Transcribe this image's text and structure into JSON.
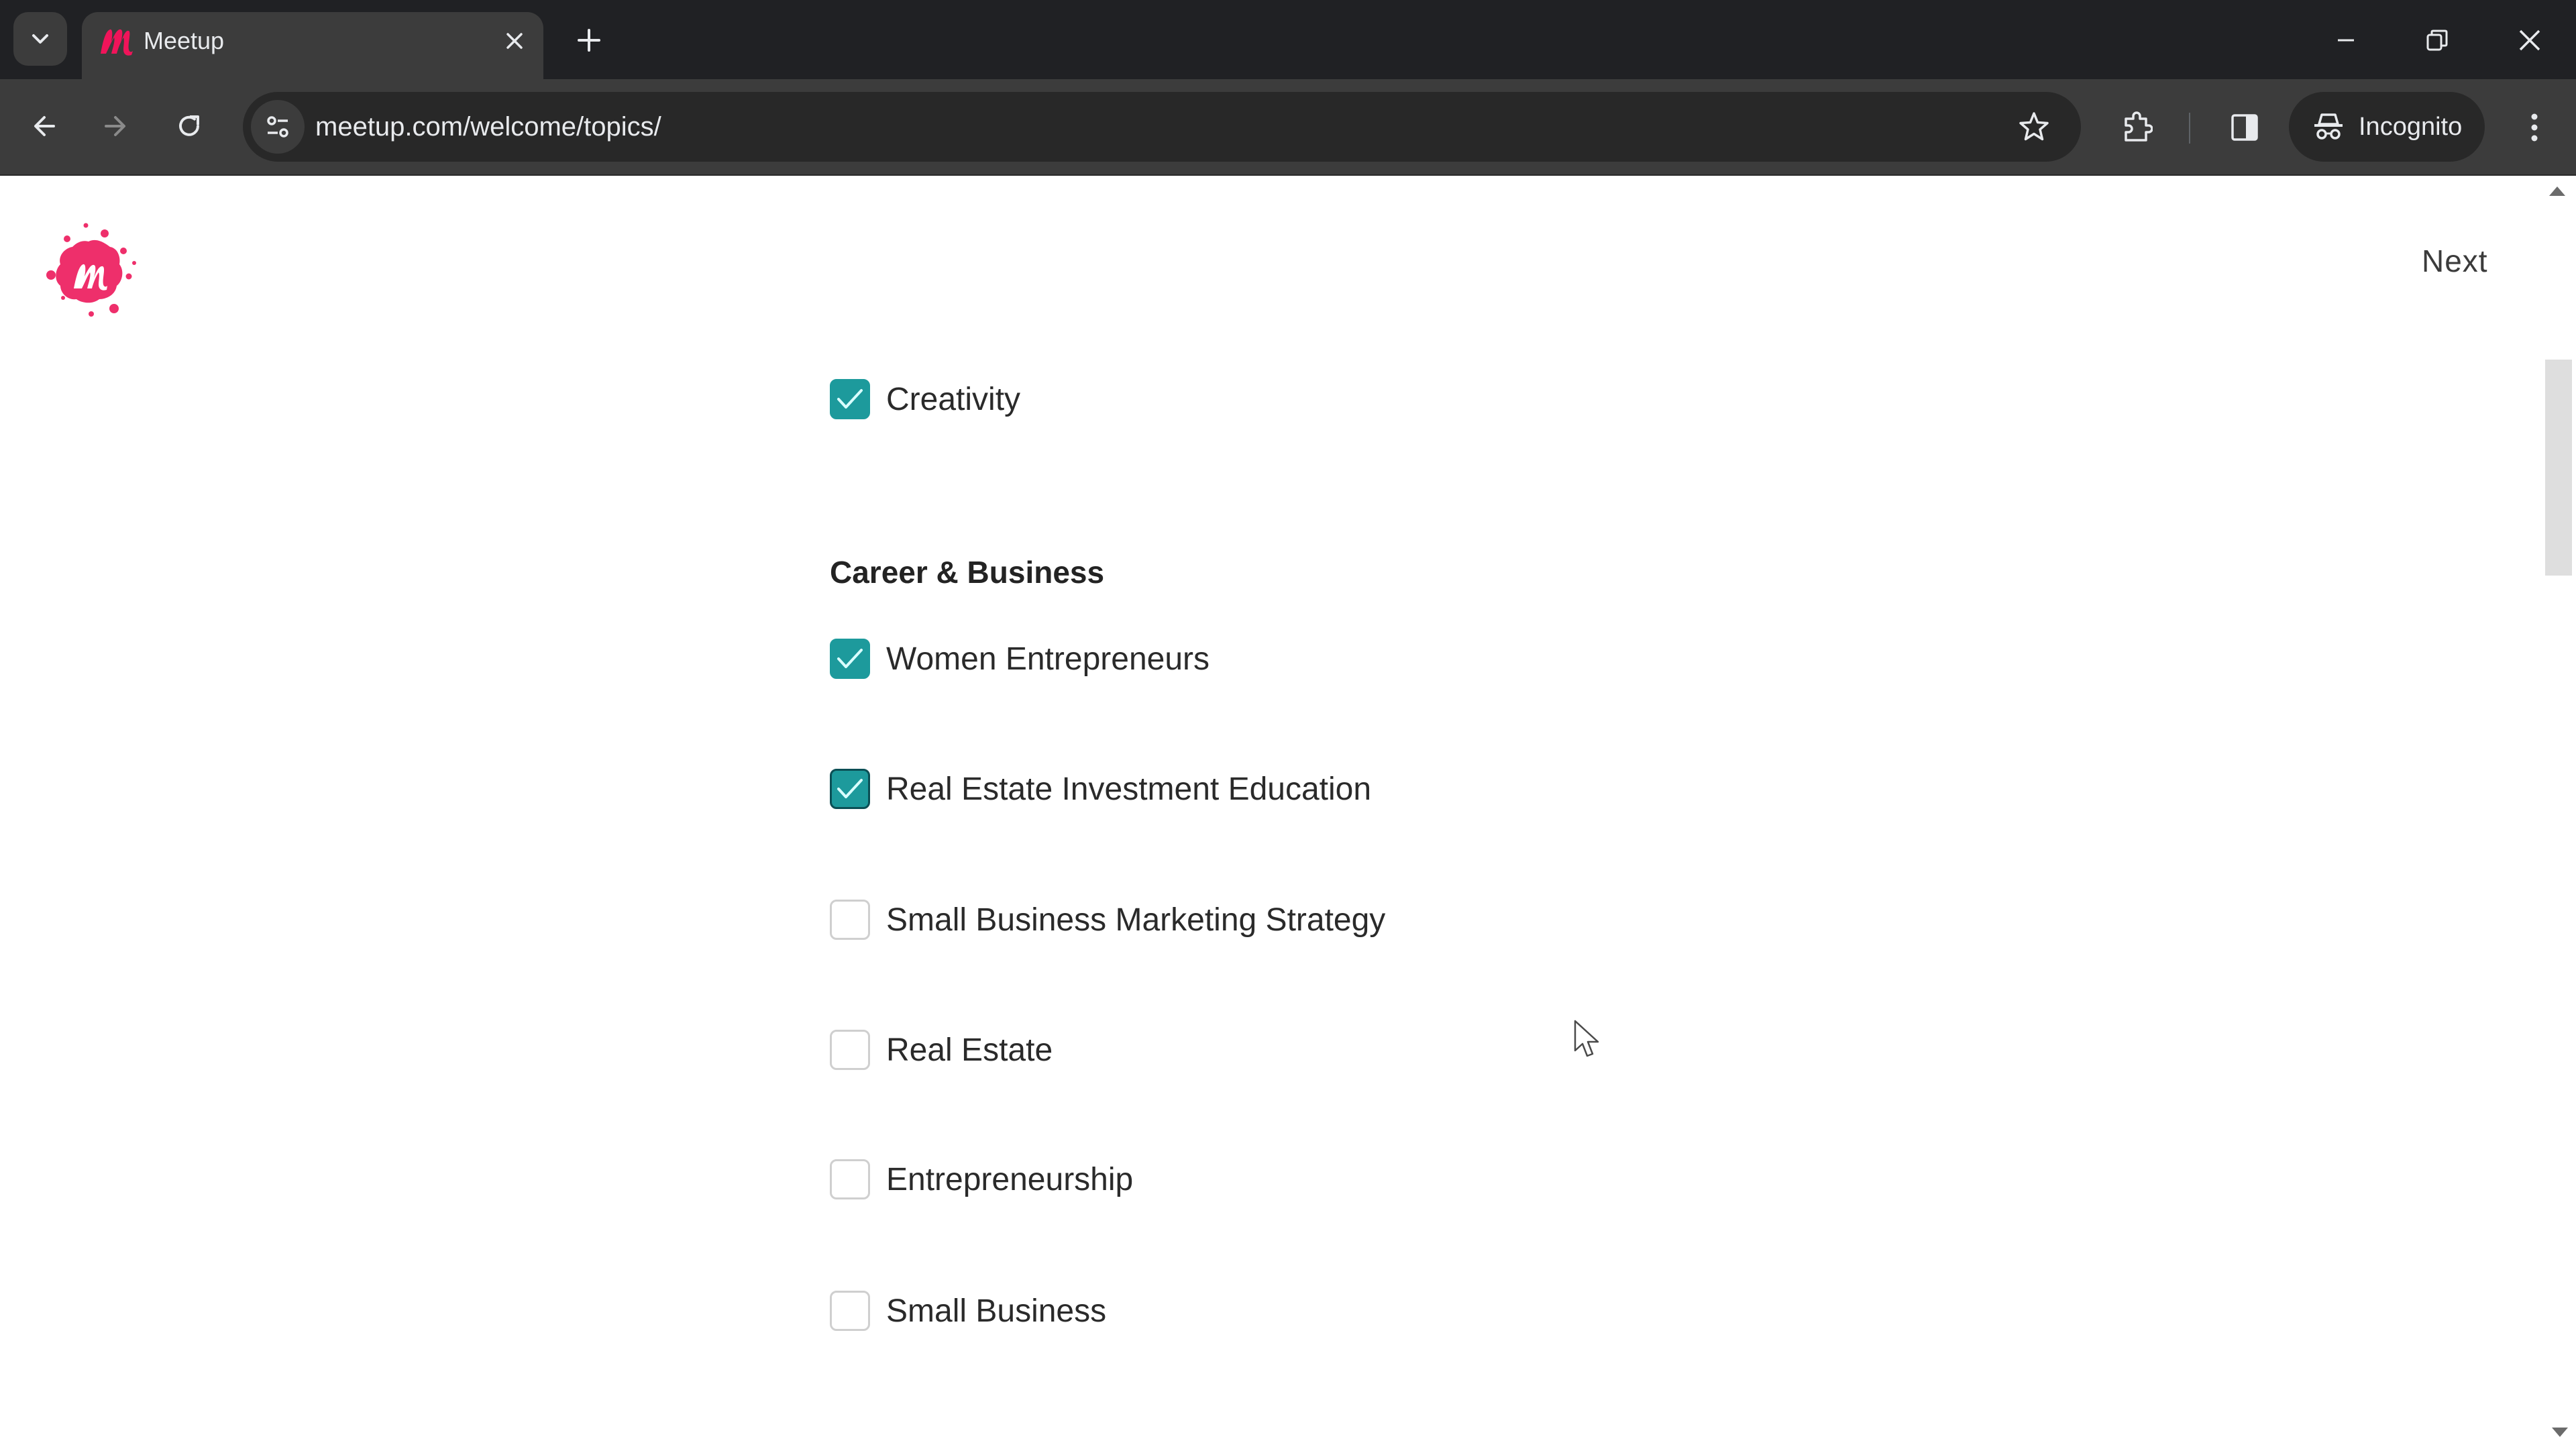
{
  "browser": {
    "tab": {
      "title": "Meetup",
      "favicon": "meetup-m-icon"
    },
    "new_tab_label": "+",
    "address": {
      "url": "meetup.com/welcome/topics/"
    },
    "incognito_label": "Incognito",
    "icons": {
      "tab_search": "chevron-down-icon",
      "tab_close": "close-icon",
      "back": "arrow-left-icon",
      "forward": "arrow-right-icon",
      "reload": "reload-icon",
      "site_info": "tune-icon",
      "bookmark": "star-icon",
      "extensions": "puzzle-icon",
      "side_panel": "side-panel-icon",
      "incognito": "incognito-icon",
      "menu": "kebab-menu-icon",
      "minimize": "minimize-icon",
      "restore": "restore-icon",
      "close": "close-window-icon"
    }
  },
  "page": {
    "brand_color": "#e32359",
    "accent_color": "#1d9a9c",
    "next_label": "Next",
    "topics_above": [
      {
        "label": "Creativity",
        "checked": true
      }
    ],
    "section": {
      "heading": "Career & Business",
      "topics": [
        {
          "label": "Women Entrepreneurs",
          "checked": true
        },
        {
          "label": "Real Estate Investment Education",
          "checked": true,
          "focused": true
        },
        {
          "label": "Small Business Marketing Strategy",
          "checked": false
        },
        {
          "label": "Real Estate",
          "checked": false
        },
        {
          "label": "Entrepreneurship",
          "checked": false
        },
        {
          "label": "Small Business",
          "checked": false
        }
      ]
    }
  }
}
